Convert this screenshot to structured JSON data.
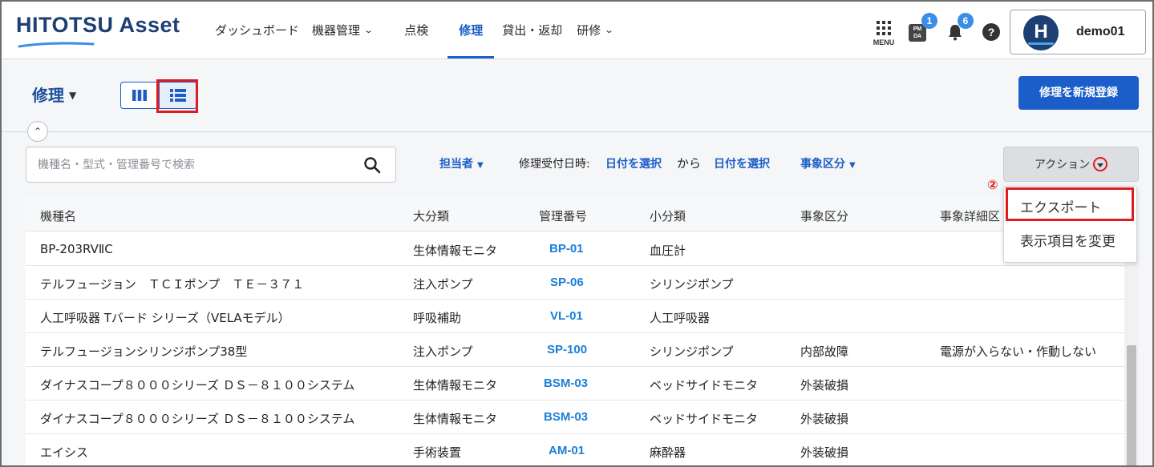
{
  "app": {
    "logo_text": "HITOTSU Asset",
    "user_initial": "H",
    "user_name": "demo01"
  },
  "nav": {
    "items": [
      {
        "label": "ダッシュボード",
        "has_dropdown": false
      },
      {
        "label": "機器管理",
        "has_dropdown": true
      },
      {
        "label": "点検",
        "has_dropdown": false
      },
      {
        "label": "修理",
        "has_dropdown": false,
        "active": true
      },
      {
        "label": "貸出・返却",
        "has_dropdown": false
      },
      {
        "label": "研修",
        "has_dropdown": true
      }
    ],
    "menu_label": "MENU",
    "pmda_label_top": "PM",
    "pmda_label_bottom": "DA",
    "pmda_badge": "1",
    "bell_badge": "6",
    "help_label": "?"
  },
  "page": {
    "title": "修理",
    "register_button": "修理を新規登録"
  },
  "filters": {
    "search_placeholder": "機種名・型式・管理番号で検索",
    "assignee": "担当者",
    "date_label": "修理受付日時:",
    "date_from": "日付を選択",
    "date_sep": "から",
    "date_to": "日付を選択",
    "event_type": "事象区分",
    "action_button": "アクション"
  },
  "dropdown": {
    "step_marker": "②",
    "items": [
      "エクスポート",
      "表示項目を変更"
    ]
  },
  "table": {
    "columns": [
      "機種名",
      "大分類",
      "管理番号",
      "小分類",
      "事象区分",
      "事象詳細区"
    ],
    "rows": [
      [
        "BP-203RVⅡC",
        "生体情報モニタ",
        "BP-01",
        "血圧計",
        "",
        ""
      ],
      [
        "テルフュージョン　ＴＣＩポンプ　ＴＥ－３７１",
        "注入ポンプ",
        "SP-06",
        "シリンジポンプ",
        "",
        ""
      ],
      [
        "人工呼吸器 Tバード シリーズ（VELAモデル）",
        "呼吸補助",
        "VL-01",
        "人工呼吸器",
        "",
        ""
      ],
      [
        "テルフュージョンシリンジポンプ38型",
        "注入ポンプ",
        "SP-100",
        "シリンジポンプ",
        "内部故障",
        "電源が入らない・作動しない"
      ],
      [
        "ダイナスコープ８０００シリーズ ＤＳ－８１００システム",
        "生体情報モニタ",
        "BSM-03",
        "ベッドサイドモニタ",
        "外装破損",
        ""
      ],
      [
        "ダイナスコープ８０００シリーズ ＤＳ－８１００システム",
        "生体情報モニタ",
        "BSM-03",
        "ベッドサイドモニタ",
        "外装破損",
        ""
      ],
      [
        "エイシス",
        "手術装置",
        "AM-01",
        "麻酔器",
        "外装破損",
        ""
      ]
    ]
  },
  "colors": {
    "brand": "#1e3f73",
    "accent": "#1b5ec9",
    "code_link": "#1b7fd6",
    "highlight": "#e21b1b"
  }
}
